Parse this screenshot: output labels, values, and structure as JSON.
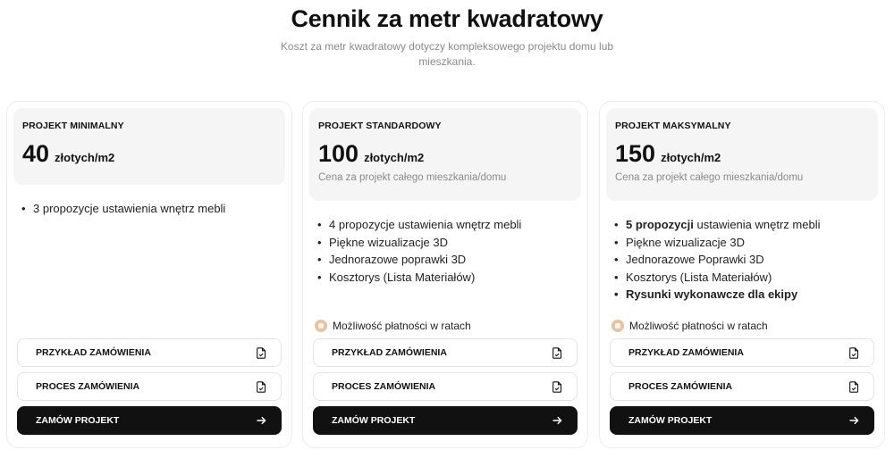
{
  "header": {
    "title": "Cennik za metr kwadratowy",
    "subtitle": "Koszt za metr kwadratowy dotyczy kompleksowego projektu domu lub mieszkania."
  },
  "plans": [
    {
      "tier": "PROJEKT MINIMALNY",
      "price": "40",
      "unit": "złotych/m2",
      "features": [
        "3 propozycje ustawienia wnętrz mebli"
      ],
      "buttons": {
        "example": "PRZYKŁAD ZAMÓWIENIA",
        "process": "PROCES ZAMÓWIENIA",
        "order": "ZAMÓW PROJEKT"
      }
    },
    {
      "tier": "PROJEKT STANDARDOWY",
      "price": "100",
      "unit": "złotych/m2",
      "note": "Cena za projekt całego mieszkania/domu",
      "features": [
        "4 propozycje ustawienia wnętrz mebli",
        "Piękne wizualizacje 3D",
        "Jednorazowe poprawki 3D",
        "Kosztorys (Lista Materiałów)"
      ],
      "installments": "Możliwość płatności w ratach",
      "buttons": {
        "example": "PRZYKŁAD ZAMÓWIENIA",
        "process": "PROCES ZAMÓWIENIA",
        "order": "ZAMÓW PROJEKT"
      }
    },
    {
      "tier": "PROJEKT MAKSYMALNY",
      "price": "150",
      "unit": "złotych/m2",
      "note": "Cena za projekt całego mieszkania/domu",
      "features": {
        "f1_bold": "5 propozycji",
        "f1_rest": " ustawienia wnętrz mebli",
        "f2": "Piękne wizualizacje 3D",
        "f3": "Jednorazowe Poprawki 3D",
        "f4": "Kosztorys (Lista Materiałów)",
        "f5": "Rysunki wykonawcze dla ekipy"
      },
      "installments": "Możliwość płatności w ratach",
      "buttons": {
        "example": "PRZYKŁAD ZAMÓWIENIA",
        "process": "PROCES ZAMÓWIENIA",
        "order": "ZAMÓW PROJEKT"
      }
    }
  ],
  "icons": {
    "document": "document-icon",
    "arrow": "arrow-right-icon",
    "installments": "coin-icon"
  },
  "colors": {
    "primary_button": "#111111",
    "card_header_bg": "#f5f5f5",
    "installments_icon": "#e5c3a3",
    "muted_text": "#8a8a8a"
  }
}
